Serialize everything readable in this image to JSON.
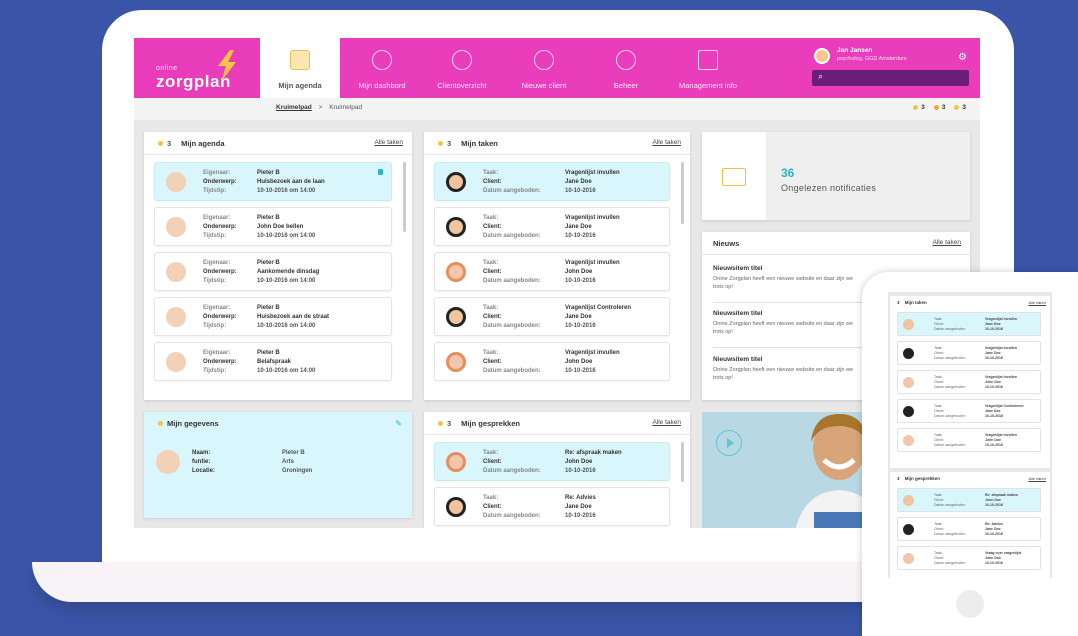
{
  "logo": {
    "small": "online",
    "big": "zorgplan"
  },
  "nav": [
    {
      "label": "Mijn agenda",
      "icon": "calendar-icon"
    },
    {
      "label": "Mijn dashbord",
      "icon": "dashboard-icon"
    },
    {
      "label": "Clientoverzicht",
      "icon": "clients-icon"
    },
    {
      "label": "Nieuwe client",
      "icon": "add-client-icon"
    },
    {
      "label": "Beheer",
      "icon": "manage-icon"
    },
    {
      "label": "Management info",
      "icon": "chart-icon"
    }
  ],
  "user": {
    "name": "Jan Jansen",
    "role": "psycholog, GGD Amsterdam"
  },
  "breadcrumb": {
    "link": "Kruimelpad",
    "sep": ">",
    "current": "Kruimelpad"
  },
  "counts": [
    {
      "value": "3",
      "color": "#f4c44a"
    },
    {
      "value": "3",
      "color": "#f4a62a"
    },
    {
      "value": "3",
      "color": "#f4c44a"
    }
  ],
  "agenda": {
    "count": "3",
    "title": "Mijn agenda",
    "link": "Alle taken",
    "items": [
      {
        "k1": "Eigenaar:",
        "v1": "Pieter B",
        "k2": "Onderwerp:",
        "v2": "Huisbezoek aan de laan",
        "k3": "Tijdstip:",
        "v3": "10-10-2016 om 14:00"
      },
      {
        "k1": "Eigenaar:",
        "v1": "Pieter B",
        "k2": "Onderwerp:",
        "v2": "John Doe bellen",
        "k3": "Tijdstip:",
        "v3": "10-10-2016 om 14:00"
      },
      {
        "k1": "Eigenaar:",
        "v1": "Pieter B",
        "k2": "Onderwerp:",
        "v2": "Aankomende dinsdag",
        "k3": "Tijdstip:",
        "v3": "10-10-2016 om 14:00"
      },
      {
        "k1": "Eigenaar:",
        "v1": "Pieter B",
        "k2": "Onderwerp:",
        "v2": "Huisbezoek aan de straat",
        "k3": "Tijdstip:",
        "v3": "10-10-2016 om 14:00"
      },
      {
        "k1": "Eigenaar:",
        "v1": "Pieter B",
        "k2": "Onderwerp:",
        "v2": "Belafspraak",
        "k3": "Tijdstip:",
        "v3": "10-10-2016 om 14:00"
      }
    ]
  },
  "taken": {
    "count": "3",
    "title": "Mijn taken",
    "link": "Alle taken",
    "items": [
      {
        "k1": "Taak:",
        "v1": "Vragenlijst invullen",
        "k2": "Client:",
        "v2": "Jane Doe",
        "k3": "Datum aangeboden:",
        "v3": "10-10-2016"
      },
      {
        "k1": "Taak:",
        "v1": "Vragenlijst invullen",
        "k2": "Client:",
        "v2": "Jane Doe",
        "k3": "Datum aangeboden:",
        "v3": "10-10-2016"
      },
      {
        "k1": "Taak:",
        "v1": "Vragenlijst invullen",
        "k2": "Client:",
        "v2": "John Doe",
        "k3": "Datum aangeboden:",
        "v3": "10-10-2016"
      },
      {
        "k1": "Taak:",
        "v1": "Vragenlijst Controleren",
        "k2": "Client:",
        "v2": "Jane Doe",
        "k3": "Datum aangeboden:",
        "v3": "10-10-2016"
      },
      {
        "k1": "Taak:",
        "v1": "Vragenlijst invullen",
        "k2": "Client:",
        "v2": "John Doe",
        "k3": "Datum aangeboden:",
        "v3": "10-10-2016"
      }
    ]
  },
  "notificaties": {
    "count": "36",
    "label": "Ongelezen notificaties"
  },
  "nieuws": {
    "title": "Nieuws",
    "link": "Alle taken",
    "items": [
      {
        "title": "Nieuwsitem titel",
        "text": "Onine Zorgplan heeft een nieuwe website en daar zijn we trots op!"
      },
      {
        "title": "Nieuwsitem titel",
        "text": "Onine Zorgplan heeft een nieuwe website en daar zijn we trots op!"
      },
      {
        "title": "Nieuwsitem titel",
        "text": "Onine Zorgplan heeft een nieuwe website en daar zijn we trots op!"
      }
    ]
  },
  "gegevens": {
    "title": "Mijn gegevens",
    "k1": "Naam:",
    "v1": "Pieter B",
    "k2": "funtie:",
    "v2": "Arts",
    "k3": "Locatie:",
    "v3": "Groningen"
  },
  "gesprekken": {
    "count": "3",
    "title": "Mijn gesprekken",
    "link": "Alle taken",
    "items": [
      {
        "k1": "Taak:",
        "v1": "Re: afspraak maken",
        "k2": "Client:",
        "v2": "John Doe",
        "k3": "Datum aangeboden:",
        "v3": "10-10-2016"
      },
      {
        "k1": "Taak:",
        "v1": "Re: Advies",
        "k2": "Client:",
        "v2": "Jane Doe",
        "k3": "Datum aangeboden:",
        "v3": "10-10-2016"
      }
    ]
  },
  "phone": {
    "taken": {
      "count": "3",
      "title": "Mijn taken",
      "link": "Alle taken",
      "items": [
        {
          "k1": "Taak:",
          "v1": "Vragenlijst invullen",
          "k2": "Client:",
          "v2": "Jane Doe",
          "k3": "Datum aangeboden:",
          "v3": "10-10-2016"
        },
        {
          "k1": "Taak:",
          "v1": "Vragenlijst invullen",
          "k2": "Client:",
          "v2": "Jane Doe",
          "k3": "Datum aangeboden:",
          "v3": "10-10-2016"
        },
        {
          "k1": "Taak:",
          "v1": "Vragenlijst invullen",
          "k2": "Client:",
          "v2": "John Doe",
          "k3": "Datum aangeboden:",
          "v3": "10-10-2016"
        },
        {
          "k1": "Taak:",
          "v1": "Vragenlijst Controleren",
          "k2": "Client:",
          "v2": "Jane Doe",
          "k3": "Datum aangeboden:",
          "v3": "10-10-2016"
        },
        {
          "k1": "Taak:",
          "v1": "Vragenlijst invullen",
          "k2": "Client:",
          "v2": "John Doe",
          "k3": "Datum aangeboden:",
          "v3": "10-10-2016"
        }
      ]
    },
    "gesprekken": {
      "count": "3",
      "title": "Mijn gesprekken",
      "link": "Alle taken",
      "items": [
        {
          "k1": "Taak:",
          "v1": "Re: afspraak maken",
          "k2": "Client:",
          "v2": "John Doe",
          "k3": "Datum aangeboden:",
          "v3": "10-10-2016"
        },
        {
          "k1": "Taak:",
          "v1": "Re: Advies",
          "k2": "Client:",
          "v2": "Jane Doe",
          "k3": "Datum aangeboden:",
          "v3": "10-10-2016"
        },
        {
          "k1": "Taak:",
          "v1": "Vraag over vragenlijst",
          "k2": "Client:",
          "v2": "John Doe",
          "k3": "Datum aangeboden:",
          "v3": "10-10-2016"
        }
      ]
    }
  },
  "colors": {
    "brand": "#ea3dbb",
    "accent": "#2bb6c8",
    "highlight": "#d8f6fb",
    "warning": "#f4c44a"
  }
}
